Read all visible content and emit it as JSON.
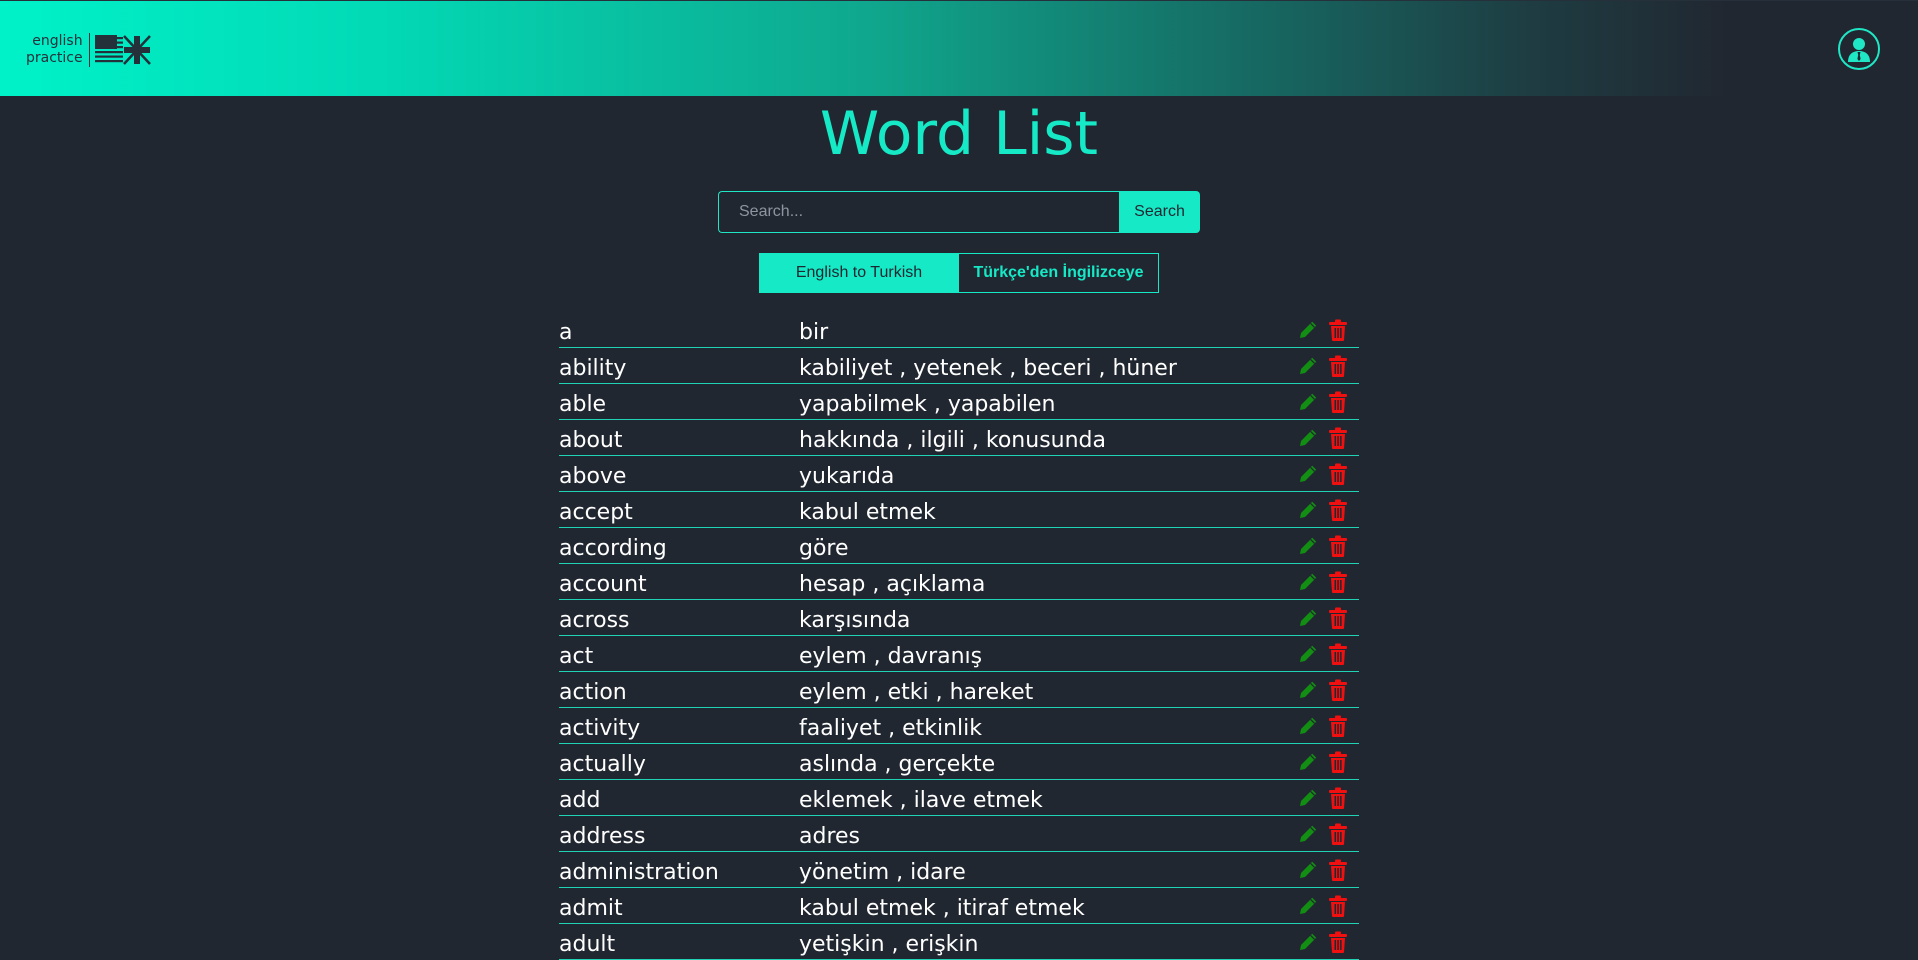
{
  "header": {
    "logo_line1": "english",
    "logo_line2": "practice"
  },
  "page": {
    "title": "Word List"
  },
  "search": {
    "placeholder": "Search...",
    "value": "",
    "button_label": "Search"
  },
  "direction": {
    "english_to_turkish": "English to Turkish",
    "turkish_to_english": "Türkçe'den İngilizceye",
    "active": "english_to_turkish"
  },
  "colors": {
    "accent": "#16e9c6",
    "background": "#212731",
    "edit": "#128f12",
    "delete": "#f01010"
  },
  "words": [
    {
      "en": "a",
      "tr": "bir"
    },
    {
      "en": "ability",
      "tr": "kabiliyet , yetenek , beceri , hüner"
    },
    {
      "en": "able",
      "tr": "yapabilmek , yapabilen"
    },
    {
      "en": "about",
      "tr": "hakkında , ilgili , konusunda"
    },
    {
      "en": "above",
      "tr": "yukarıda"
    },
    {
      "en": "accept",
      "tr": "kabul etmek"
    },
    {
      "en": "according",
      "tr": "göre"
    },
    {
      "en": "account",
      "tr": "hesap , açıklama"
    },
    {
      "en": "across",
      "tr": "karşısında"
    },
    {
      "en": "act",
      "tr": "eylem , davranış"
    },
    {
      "en": "action",
      "tr": "eylem , etki , hareket"
    },
    {
      "en": "activity",
      "tr": "faaliyet , etkinlik"
    },
    {
      "en": "actually",
      "tr": "aslında , gerçekte"
    },
    {
      "en": "add",
      "tr": "eklemek , ilave etmek"
    },
    {
      "en": "address",
      "tr": "adres"
    },
    {
      "en": "administration",
      "tr": "yönetim , idare"
    },
    {
      "en": "admit",
      "tr": "kabul etmek , itiraf etmek"
    },
    {
      "en": "adult",
      "tr": "yetişkin , erişkin"
    }
  ]
}
